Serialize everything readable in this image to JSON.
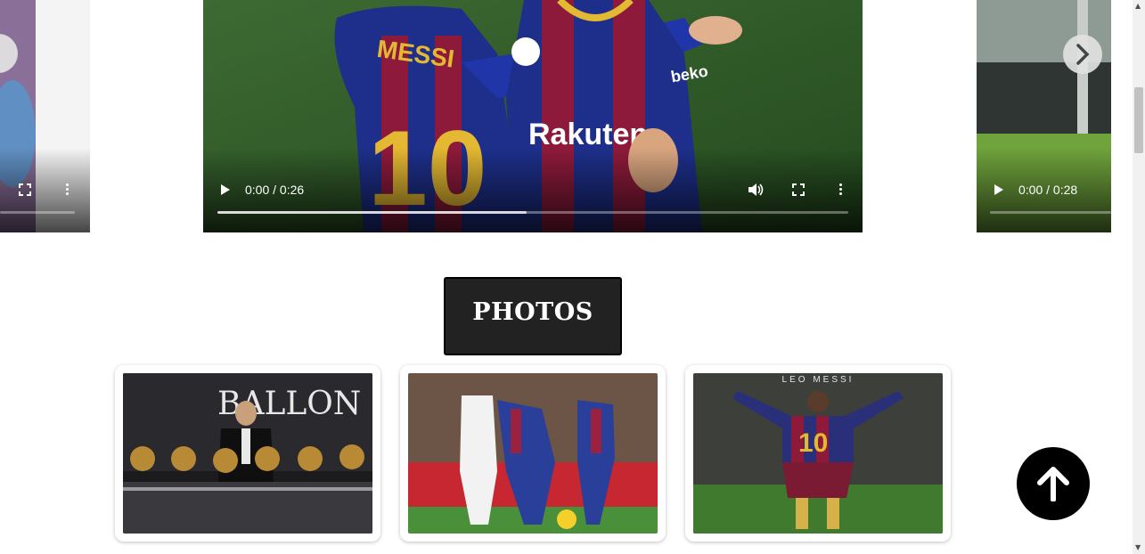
{
  "carousel": {
    "main_video": {
      "time": "0:00 / 0:26",
      "progress": 0.0
    },
    "right_video": {
      "time": "0:00 / 0:28",
      "progress": 0.0
    }
  },
  "photos_section": {
    "heading": "PHOTOS",
    "photos": [
      {
        "caption_text": "BALLON D'OR"
      },
      {
        "caption_text": ""
      },
      {
        "caption_text": "LEO MESSI"
      }
    ]
  },
  "jersey_texts": {
    "name": "MESSI",
    "number": "10",
    "sponsor": "Rakuten",
    "brand": "beko"
  },
  "icons": [
    "play-icon",
    "volume-icon",
    "fullscreen-icon",
    "more-icon",
    "chevron-right-icon",
    "arrow-up-icon"
  ],
  "colors": {
    "heading_bg": "#222222",
    "to_top_bg": "#000000"
  }
}
